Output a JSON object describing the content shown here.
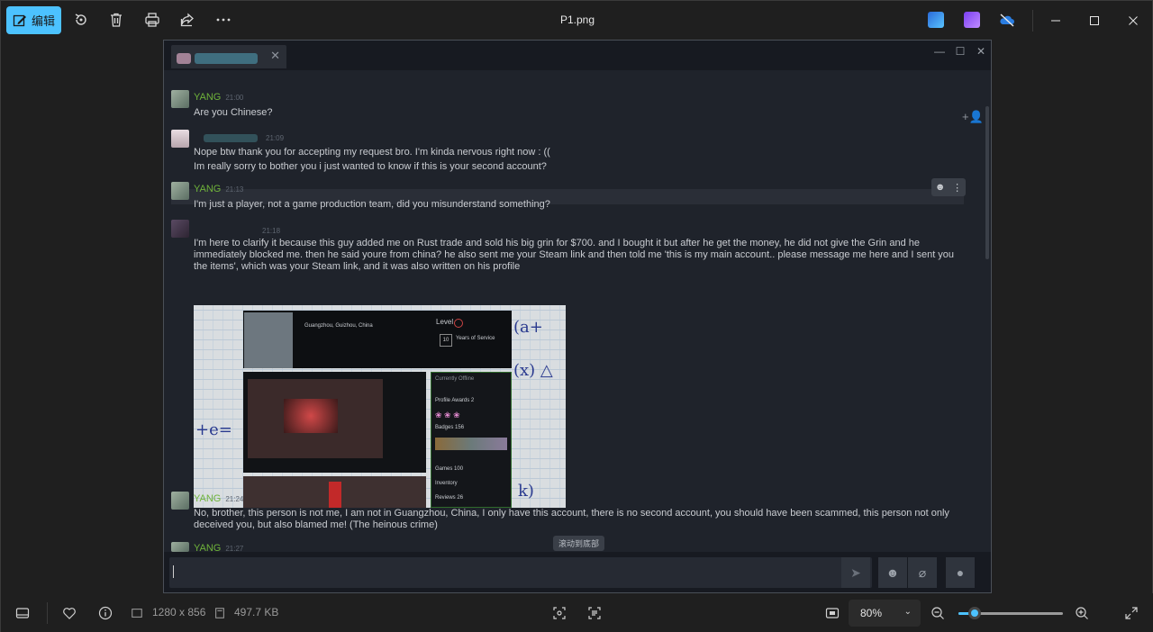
{
  "toolbar": {
    "edit_label": "编辑",
    "title": "P1.png",
    "icons": [
      "rotate-icon",
      "delete-icon",
      "print-icon",
      "share-icon",
      "more-icon"
    ]
  },
  "chat": {
    "messages": [
      {
        "sender": "YANG",
        "time": "21:00",
        "lines": [
          "Are you Chinese?"
        ]
      },
      {
        "sender": "",
        "time": "21:09",
        "lines": [
          "Nope btw thank you for accepting my request bro. I'm kinda nervous right now : ((",
          "Im really sorry to bother you i just wanted to know if this is your second account?"
        ]
      },
      {
        "sender": "YANG",
        "time": "21:13",
        "lines": [
          "I'm just a player, not a game production team, did you misunderstand something?"
        ]
      },
      {
        "sender": "",
        "time": "21:18",
        "lines": [
          "I'm here to clarify it because this guy added me on Rust trade and sold his big grin for $700. and I bought it but after he get the money, he did not give the Grin and he immediately blocked me. then he said youre from china? he also sent me your Steam link and then told me 'this is my main account.. please message me here and I sent you the items', which was your Steam link, and it was also written on his profile"
        ]
      },
      {
        "sender": "YANG",
        "time": "21:24",
        "lines": [
          "No, brother, this person is not me, I am not in Guangzhou, China, I only have this account, there is no second account, you should have been scammed, this person not only deceived you, but also blamed me! (The heinous crime)"
        ]
      },
      {
        "sender": "YANG",
        "time": "21:27",
        "lines": []
      }
    ],
    "embedded": {
      "location": "Guangzhou, Guizhou, China",
      "level_label": "Level",
      "years": "10",
      "years_label": "Years of Service",
      "status": "Currently Offline",
      "awards_label": "Profile Awards",
      "awards_count": "2",
      "badges_label": "Badges",
      "badges_count": "156",
      "games_label": "Games",
      "games_count": "100",
      "inventory_label": "Inventory",
      "reviews_label": "Reviews",
      "reviews_count": "26"
    },
    "scroll_to_bottom": "滚动到底部"
  },
  "statusbar": {
    "dimensions": "1280 x 856",
    "filesize": "497.7 KB",
    "zoom": "80%",
    "zoom_fraction": 0.15
  },
  "colors": {
    "accent": "#4cc2ff",
    "sender_green": "#6fb33a"
  }
}
